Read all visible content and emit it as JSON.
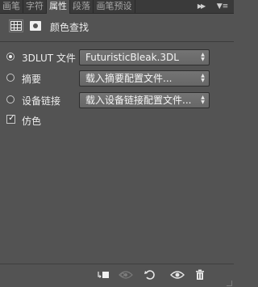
{
  "tabs": [
    {
      "label": "画笔",
      "active": false
    },
    {
      "label": "字符",
      "active": false
    },
    {
      "label": "属性",
      "active": true
    },
    {
      "label": "段落",
      "active": false
    },
    {
      "label": "画笔预设",
      "active": false
    }
  ],
  "tab_overflow_icon": "double-chevron-right-icon",
  "panel_menu_icon": "panel-menu-icon",
  "header": {
    "icons": [
      "grid-lut-icon",
      "layer-mask-icon"
    ],
    "title": "颜色查找"
  },
  "options": [
    {
      "label": "3DLUT 文件",
      "checked": true,
      "dropdown": "FuturisticBleak.3DL"
    },
    {
      "label": "摘要",
      "checked": false,
      "dropdown": "载入摘要配置文件..."
    },
    {
      "label": "设备链接",
      "checked": false,
      "dropdown": "载入设备链接配置文件..."
    }
  ],
  "dither": {
    "label": "仿色",
    "checked": true
  },
  "footer_icons": [
    "clip-to-layer-icon",
    "view-previous-state-icon",
    "reset-icon",
    "visibility-eye-icon",
    "trash-icon"
  ],
  "colors": {
    "panel_bg": "#535353",
    "tabbar_bg": "#3a3a3a",
    "text": "#ececec",
    "dropdown_bg": "#6e6e6e"
  }
}
